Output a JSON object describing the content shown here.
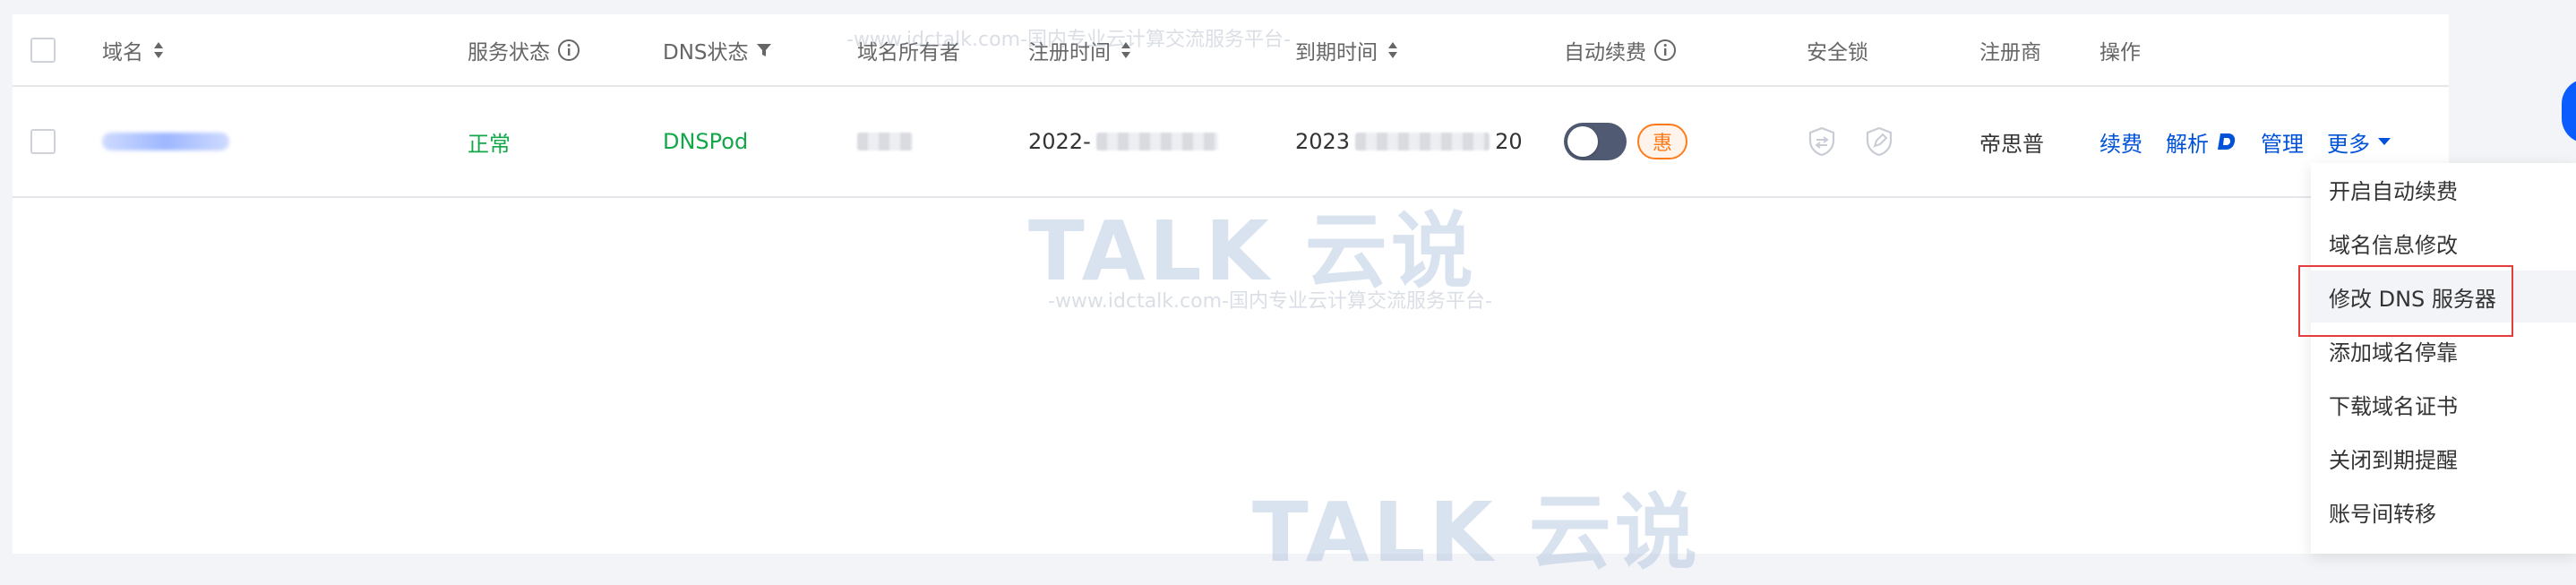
{
  "table": {
    "headers": {
      "domain": "域名",
      "service_status": "服务状态",
      "dns_status": "DNS状态",
      "owner": "域名所有者",
      "reg_time": "注册时间",
      "expire_time": "到期时间",
      "auto_renew": "自动续费",
      "security_lock": "安全锁",
      "registrar": "注册商",
      "actions": "操作"
    },
    "row": {
      "service_status": "正常",
      "dns_status": "DNSPod",
      "reg_time_prefix": "2022-",
      "expire_time_prefix": "2023",
      "expire_time_suffix": "20",
      "promo_badge": "惠",
      "registrar": "帝思普",
      "actions": {
        "renew": "续费",
        "resolve": "解析",
        "manage": "管理",
        "more": "更多"
      }
    }
  },
  "dropdown": {
    "items": [
      "开启自动续费",
      "域名信息修改",
      "修改 DNS 服务器",
      "添加域名停靠",
      "下载域名证书",
      "关闭到期提醒",
      "账号间转移"
    ]
  },
  "watermark": {
    "logo": "TALK 云说",
    "line": "-www.idctalk.com-国内专业云计算交流服务平台-"
  },
  "colors": {
    "link": "#0052d9",
    "success": "#14a74a",
    "promo": "#ff7a1a",
    "highlight": "#e33d3d"
  }
}
